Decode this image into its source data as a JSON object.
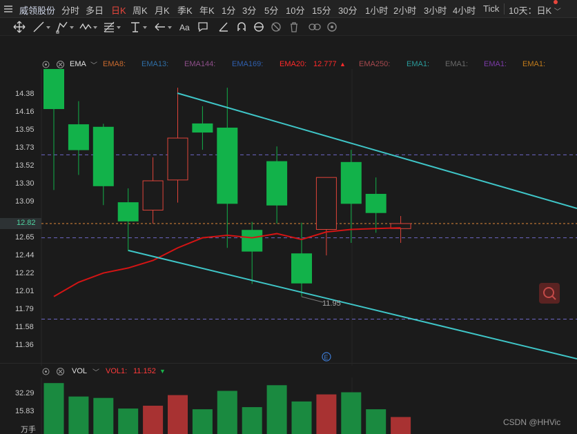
{
  "topbar": {
    "stock_name": "威领股份",
    "periods": [
      "分时",
      "多日",
      "日K",
      "周K",
      "月K",
      "季K",
      "年K",
      "1分",
      "3分",
      "5分",
      "10分",
      "15分",
      "30分",
      "1小时",
      "2小时",
      "3小时",
      "4小时",
      "Tick"
    ],
    "active_period": "日K",
    "range_selector": "10天：日K"
  },
  "toolbar": {
    "tools": [
      "move-icon",
      "line-icon",
      "path-icon",
      "wave-icon",
      "fib-icon",
      "vertical-line-icon",
      "arrow-icon",
      "text-icon",
      "comment-icon",
      "measure-icon",
      "magnet-icon",
      "eye-icon",
      "hide-icon",
      "trash-icon",
      "link-icon",
      "settings-icon"
    ]
  },
  "main_legend": {
    "indicator": "EMA",
    "items": [
      {
        "label": "EMA8:",
        "color": "#c96a2e"
      },
      {
        "label": "EMA13:",
        "color": "#2f6ea6"
      },
      {
        "label": "EMA144:",
        "color": "#8e4f8a"
      },
      {
        "label": "EMA169:",
        "color": "#2f5fae"
      },
      {
        "label": "EMA20:",
        "color": "#ff2a2a",
        "value": "12.777",
        "trend": "▲"
      },
      {
        "label": "EMA250:",
        "color": "#a6494e"
      },
      {
        "label": "EMA1:",
        "color": "#2a9a9a"
      },
      {
        "label": "EMA1:",
        "color": "#6a6a6a"
      },
      {
        "label": "EMA1:",
        "color": "#7a3aa6"
      },
      {
        "label": "EMA1:",
        "color": "#c07a1a"
      }
    ]
  },
  "price_axis": {
    "ticks": [
      "14.38",
      "14.16",
      "13.95",
      "13.73",
      "13.52",
      "13.30",
      "13.09",
      "12.65",
      "12.44",
      "12.22",
      "12.01",
      "11.79",
      "11.58",
      "11.36"
    ],
    "last_price": "12.82"
  },
  "low_annotation": "11.95",
  "event_marker": "E",
  "chart_data": {
    "type": "candlestick",
    "ylim": [
      11.2,
      14.6
    ],
    "candles": [
      {
        "open": 14.19,
        "close": 14.78,
        "high": 14.78,
        "low": 13.22,
        "up": false
      },
      {
        "open": 14.0,
        "close": 13.7,
        "high": 14.28,
        "low": 13.4,
        "up": false
      },
      {
        "open": 13.97,
        "close": 13.27,
        "high": 14.01,
        "low": 13.04,
        "up": false
      },
      {
        "open": 13.07,
        "close": 12.85,
        "high": 13.24,
        "low": 12.49,
        "up": false
      },
      {
        "open": 12.98,
        "close": 13.33,
        "high": 13.61,
        "low": 12.82,
        "up": true
      },
      {
        "open": 13.34,
        "close": 13.84,
        "high": 14.44,
        "low": 13.07,
        "up": true
      },
      {
        "open": 14.01,
        "close": 13.91,
        "high": 14.22,
        "low": 13.7,
        "up": false
      },
      {
        "open": 13.96,
        "close": 13.06,
        "high": 14.44,
        "low": 12.53,
        "up": false
      },
      {
        "open": 12.74,
        "close": 12.49,
        "high": 12.84,
        "low": 12.1,
        "up": false
      },
      {
        "open": 13.56,
        "close": 13.04,
        "high": 13.74,
        "low": 12.82,
        "up": false
      },
      {
        "open": 12.46,
        "close": 12.11,
        "high": 12.83,
        "low": 11.95,
        "up": false
      },
      {
        "open": 12.75,
        "close": 13.37,
        "high": 13.37,
        "low": 12.44,
        "up": true
      },
      {
        "open": 13.55,
        "close": 13.06,
        "high": 13.7,
        "low": 12.59,
        "up": false
      },
      {
        "open": 13.17,
        "close": 12.95,
        "high": 13.37,
        "low": 12.71,
        "up": false
      },
      {
        "open": 12.76,
        "close": 12.82,
        "high": 12.91,
        "low": 12.59,
        "up": true
      }
    ],
    "ema20": [
      11.95,
      12.12,
      12.23,
      12.29,
      12.38,
      12.53,
      12.65,
      12.68,
      12.65,
      12.7,
      12.63,
      12.72,
      12.75,
      12.76,
      12.77
    ],
    "guide_lines": [
      13.64,
      12.82,
      12.65,
      11.68
    ]
  },
  "volume_legend": {
    "indicator": "VOL",
    "vol1_label": "VOL1:",
    "vol1_value": "11.152",
    "trend": "▼"
  },
  "volume_axis": {
    "ticks": [
      "32.29",
      "15.83"
    ],
    "unit": "万手"
  },
  "volume_data": {
    "max": 40.0,
    "values": [
      36.0,
      26.5,
      25.5,
      18.0,
      20.0,
      27.5,
      17.5,
      30.5,
      19.0,
      34.5,
      23.0,
      28.0,
      29.5,
      17.5,
      12.0
    ],
    "up": [
      false,
      false,
      false,
      false,
      true,
      true,
      false,
      false,
      false,
      false,
      false,
      true,
      false,
      false,
      true
    ]
  },
  "watermark": "CSDN @HHVic"
}
